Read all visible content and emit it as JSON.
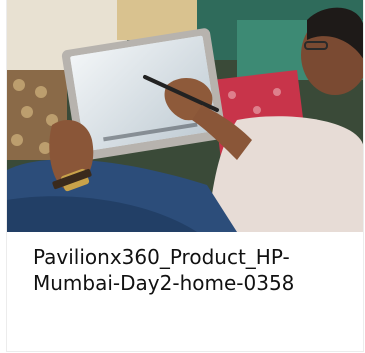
{
  "card": {
    "image": {
      "subject": "person using a convertible laptop in tablet mode with a stylus"
    },
    "caption": "Pavilionx360_Product_HP-Mumbai-Day2-home-0358"
  }
}
